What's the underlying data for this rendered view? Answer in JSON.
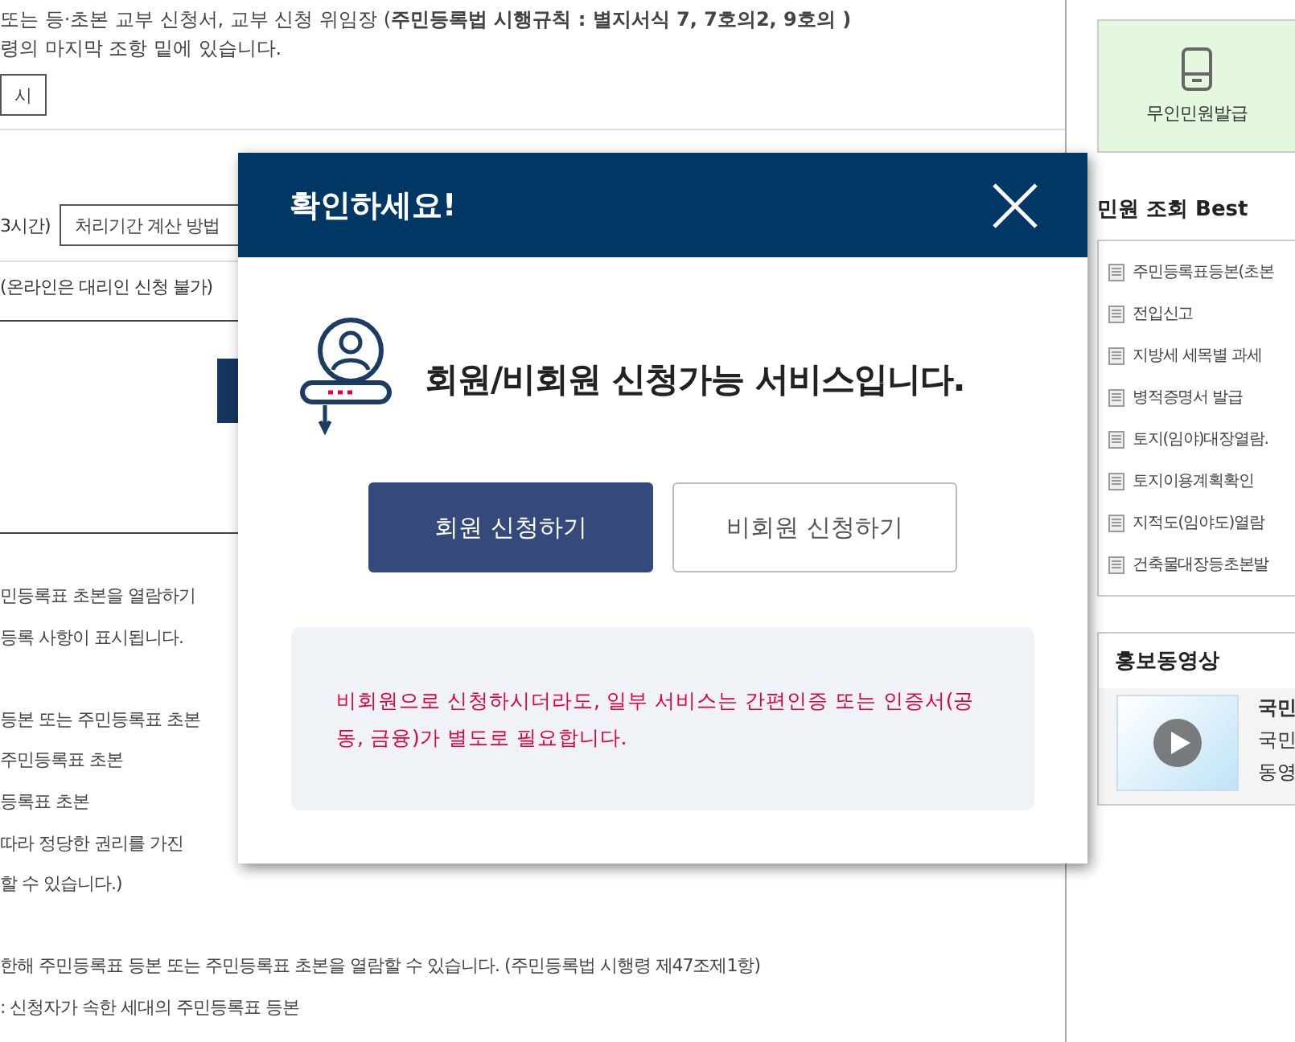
{
  "content": {
    "intro": [
      "또는 등·초본 교부 신청서, 교부 신청 위임장 (**주민등록법 시행규칙 : 별지서식 7, 7호의2, 9호의 )**",
      "령의 마지막 조항 밑에 있습니다."
    ],
    "view_button": "시",
    "period": {
      "text": "3시간)",
      "button": "처리기간 계산 방법"
    },
    "proxy_note": "(온라인은 대리인 신청 불가)",
    "body_groups": [
      [
        "민등록표 초본을 열람하기",
        "등록 사항이 표시됩니다."
      ],
      [
        "등본 또는 주민등록표 초본",
        "주민등록표 초본",
        "등록표 초본",
        "따라 정당한 권리를 가진",
        "할 수 있습니다.)"
      ],
      [
        "한해 주민등록표 등본 또는 주민등록표 초본을 열람할 수 있습니다. (주민등록법 시행령 제47조제1항)",
        ": 신청자가 속한 세대의 주민등록표 등본"
      ]
    ]
  },
  "sidebar": {
    "kiosk": {
      "label": "무인민원발급"
    },
    "best": {
      "title": "민원 조회 Best",
      "items": [
        "주민등록표등본(초본",
        "전입신고",
        "지방세 세목별 과세",
        "병적증명서 발급",
        "토지(임야)대장열람.",
        "토지이용계획확인",
        "지적도(임야도)열람",
        "건축물대장등초본발"
      ]
    },
    "video": {
      "title": "홍보동영상",
      "item_title": "국민",
      "item_lines": [
        "국민",
        "동영"
      ]
    }
  },
  "modal": {
    "title": "확인하세요!",
    "message": "회원/비회원 신청가능 서비스입니다.",
    "buttons": [
      {
        "label": "회원 신청하기",
        "kind": "primary"
      },
      {
        "label": "비회원 신청하기",
        "kind": "secondary"
      }
    ],
    "notice": "비회원으로 신청하시더라도, 일부 서비스는 간편인증 또는 인증서(공동, 금융)가 별도로 필요합니다."
  }
}
